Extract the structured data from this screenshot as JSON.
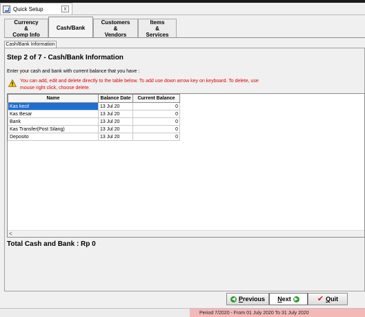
{
  "window": {
    "title": "Quick Setup",
    "close_label": "x"
  },
  "tabs": [
    {
      "label": "Currency\n&\nComp Info",
      "active": false
    },
    {
      "label": "Cash/Bank",
      "active": true
    },
    {
      "label": "Customers\n&\nVendors",
      "active": false
    },
    {
      "label": "Items\n&\nServices",
      "active": false
    }
  ],
  "sub_tab": "Cash/Bank Information",
  "step_title": "Step 2 of 7   - Cash/Bank Information",
  "instructions": "Enter your cash and bank with current balance that you have :",
  "warning": {
    "icon": "warning-icon",
    "text": "You can add, edit and delete directly to the table below. To add use down arrow key on keyboard. To delete, use mouse right click, choose delete."
  },
  "table": {
    "headers": [
      "Name",
      "Balance Date",
      "Current Balance"
    ],
    "rows": [
      [
        "Kas kecil",
        "13 Jul 20",
        "0"
      ],
      [
        "Kas Besar",
        "13 Jul 20",
        "0"
      ],
      [
        "Bank",
        "13 Jul 20",
        "0"
      ],
      [
        "Kas Transfer(Post Silang)",
        "13 Jul 20",
        "0"
      ],
      [
        "Deposito",
        "13 Jul 20",
        "0"
      ]
    ],
    "selected_row": 0,
    "scroll_left_glyph": "<"
  },
  "total": "Total Cash and Bank : Rp 0",
  "buttons": {
    "previous": {
      "pre": "",
      "u": "P",
      "post": "revious"
    },
    "next": {
      "u": "N",
      "post": "ext"
    },
    "quit": {
      "u": "Q",
      "post": "uit"
    }
  },
  "status": {
    "period": "Period 7/2020 - From 01 July 2020 To 31 July 2020"
  },
  "colors": {
    "selection": "#1c6fd1",
    "warning_text": "#e00000",
    "period_bg": "#f4b8b8"
  }
}
